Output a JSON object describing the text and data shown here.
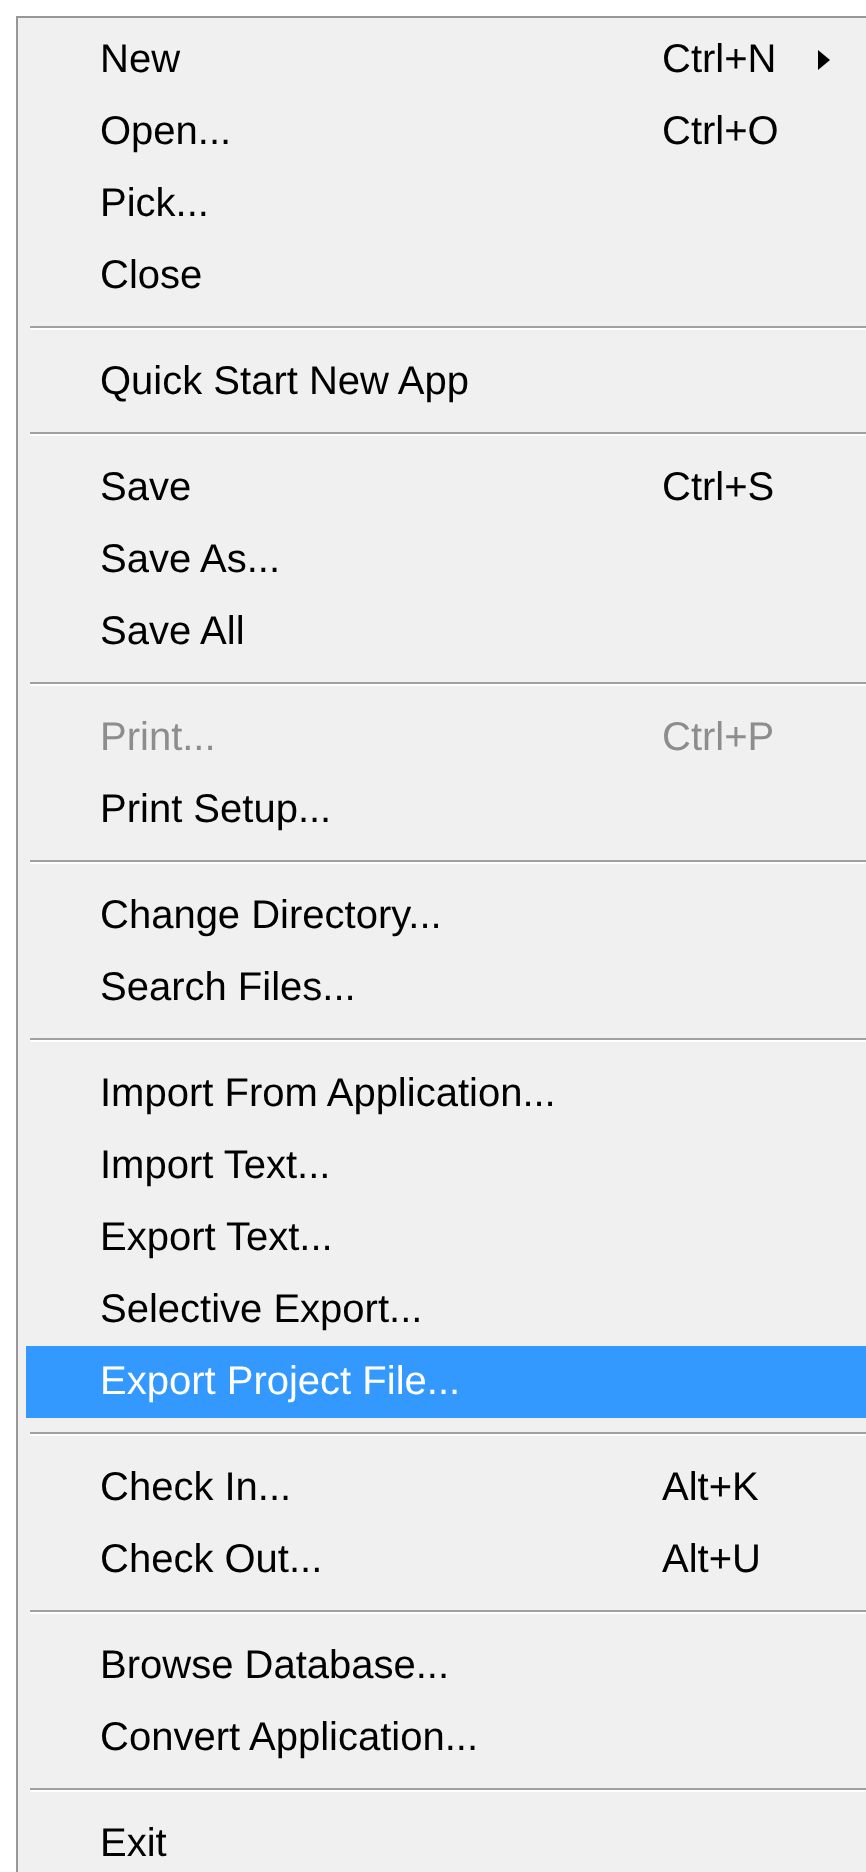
{
  "menu": {
    "groups": [
      {
        "items": [
          {
            "label": "New",
            "shortcut": "Ctrl+N",
            "submenu": true,
            "disabled": false,
            "selected": false
          },
          {
            "label": "Open...",
            "shortcut": "Ctrl+O",
            "submenu": false,
            "disabled": false,
            "selected": false
          },
          {
            "label": "Pick...",
            "submenu": false,
            "disabled": false,
            "selected": false
          },
          {
            "label": "Close",
            "submenu": false,
            "disabled": false,
            "selected": false
          }
        ]
      },
      {
        "items": [
          {
            "label": "Quick Start New App",
            "submenu": false,
            "disabled": false,
            "selected": false
          }
        ]
      },
      {
        "items": [
          {
            "label": "Save",
            "shortcut": "Ctrl+S",
            "submenu": false,
            "disabled": false,
            "selected": false
          },
          {
            "label": "Save As...",
            "submenu": false,
            "disabled": false,
            "selected": false
          },
          {
            "label": "Save All",
            "submenu": false,
            "disabled": false,
            "selected": false
          }
        ]
      },
      {
        "items": [
          {
            "label": "Print...",
            "shortcut": "Ctrl+P",
            "submenu": false,
            "disabled": true,
            "selected": false
          },
          {
            "label": "Print Setup...",
            "submenu": false,
            "disabled": false,
            "selected": false
          }
        ]
      },
      {
        "items": [
          {
            "label": "Change Directory...",
            "submenu": false,
            "disabled": false,
            "selected": false
          },
          {
            "label": "Search Files...",
            "submenu": false,
            "disabled": false,
            "selected": false
          }
        ]
      },
      {
        "items": [
          {
            "label": "Import From Application...",
            "submenu": false,
            "disabled": false,
            "selected": false
          },
          {
            "label": "Import Text...",
            "submenu": false,
            "disabled": false,
            "selected": false
          },
          {
            "label": "Export Text...",
            "submenu": false,
            "disabled": false,
            "selected": false
          },
          {
            "label": "Selective Export...",
            "submenu": false,
            "disabled": false,
            "selected": false
          },
          {
            "label": "Export Project File...",
            "submenu": false,
            "disabled": false,
            "selected": true
          }
        ]
      },
      {
        "items": [
          {
            "label": "Check In...",
            "shortcut": "Alt+K",
            "submenu": false,
            "disabled": false,
            "selected": false
          },
          {
            "label": "Check Out...",
            "shortcut": "Alt+U",
            "submenu": false,
            "disabled": false,
            "selected": false
          }
        ]
      },
      {
        "items": [
          {
            "label": "Browse Database...",
            "submenu": false,
            "disabled": false,
            "selected": false
          },
          {
            "label": "Convert Application...",
            "submenu": false,
            "disabled": false,
            "selected": false
          }
        ]
      },
      {
        "items": [
          {
            "label": "Exit",
            "submenu": false,
            "disabled": false,
            "selected": false
          }
        ]
      }
    ]
  }
}
